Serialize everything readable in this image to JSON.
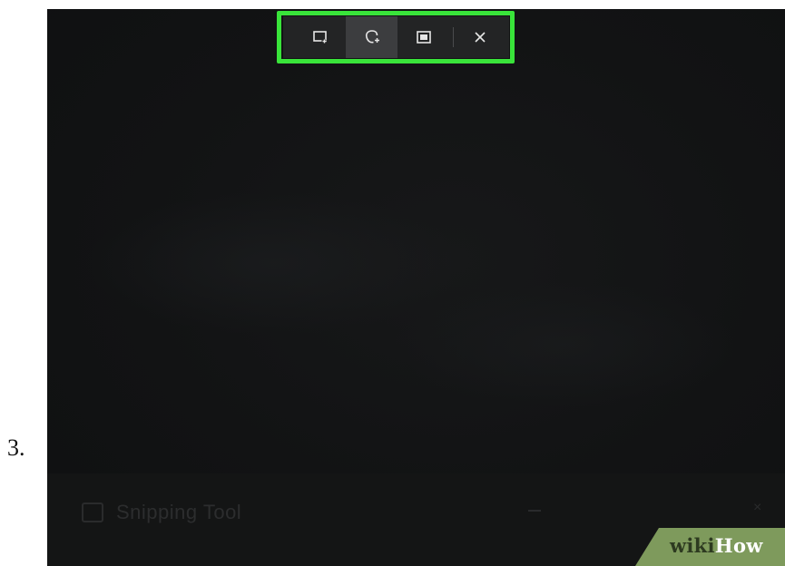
{
  "step": {
    "number": "3."
  },
  "snip_toolbar": {
    "buttons": [
      {
        "name": "rectangular-snip",
        "icon": "rectangle-snip-icon",
        "active": false
      },
      {
        "name": "freeform-snip",
        "icon": "freeform-snip-icon",
        "active": true
      },
      {
        "name": "fullscreen-snip",
        "icon": "fullscreen-snip-icon",
        "active": false
      }
    ],
    "close_icon": "close-icon",
    "highlight_color": "#39e43a"
  },
  "taskbar": {
    "app_title": "Snipping Tool"
  },
  "watermark": {
    "wiki": "wiki",
    "how": "How",
    "accent": "#7e9a5c"
  }
}
